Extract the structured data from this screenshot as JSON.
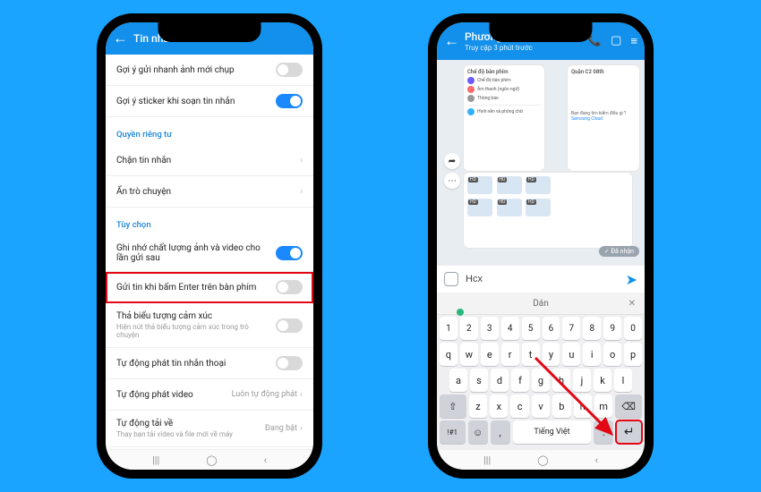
{
  "settings": {
    "header_title": "Tin nhắn",
    "rows": {
      "suggest_photos": "Gợi ý gửi nhanh ảnh mới chụp",
      "suggest_sticker": "Gợi ý sticker khi soạn tin nhắn",
      "section_privacy": "Quyền riêng tư",
      "block": "Chặn tin nhắn",
      "hide": "Ẩn trò chuyện",
      "section_options": "Tùy chọn",
      "remember_quality": "Ghi nhớ chất lượng ảnh và video cho lần gửi sau",
      "enter_send": "Gửi tin khi bấm Enter trên bàn phím",
      "drop_emoji": "Thả biểu tượng cảm xúc",
      "drop_emoji_sub": "Hiện nút thả biểu tượng cảm xúc trong trò chuyện",
      "autoplay_voice": "Tự động phát tin nhắn thoại",
      "autoplay_video": "Tự động phát video",
      "autoplay_video_val": "Luôn tự động phát",
      "autodl": "Tự động tải về",
      "autodl_sub": "Thay bạn tải video và file mới về máy",
      "autodl_val": "Đang bật"
    }
  },
  "chat": {
    "name": "Phương",
    "status": "Truy cập 3 phút trước",
    "received": "✓ Đã nhận",
    "input_value": "Hcx",
    "suggestion": "Dán",
    "card_title": "Chế độ bàn phím",
    "card2_title": "Quận C2 08th",
    "card2_line1": "Chế độ bàn phím",
    "card2_line2": "Âm thanh (ngôn ngữ)",
    "card2_line3": "Thông báo",
    "card2_line4": "Hình nền và phông chữ",
    "card3_line": "Bạn đang tìm kiếm điều gì ?",
    "card3_brand": "Samsung Cloud",
    "keyboard": {
      "row_num": [
        "1",
        "2",
        "3",
        "4",
        "5",
        "6",
        "7",
        "8",
        "9",
        "0"
      ],
      "row1": [
        "q",
        "w",
        "e",
        "r",
        "t",
        "y",
        "u",
        "i",
        "o",
        "p"
      ],
      "row2": [
        "a",
        "s",
        "d",
        "f",
        "g",
        "h",
        "j",
        "k",
        "l"
      ],
      "row3_shift": "⇧",
      "row3": [
        "z",
        "x",
        "c",
        "v",
        "b",
        "n",
        "m"
      ],
      "row3_del": "⌫",
      "row4_sym": "!#1",
      "row4_lang": "Tiếng Việt",
      "row4_comma": ",",
      "row4_period": ".",
      "row4_enter": "↵"
    }
  },
  "nav": {
    "a": "|||",
    "b": "◯",
    "c": "‹"
  }
}
